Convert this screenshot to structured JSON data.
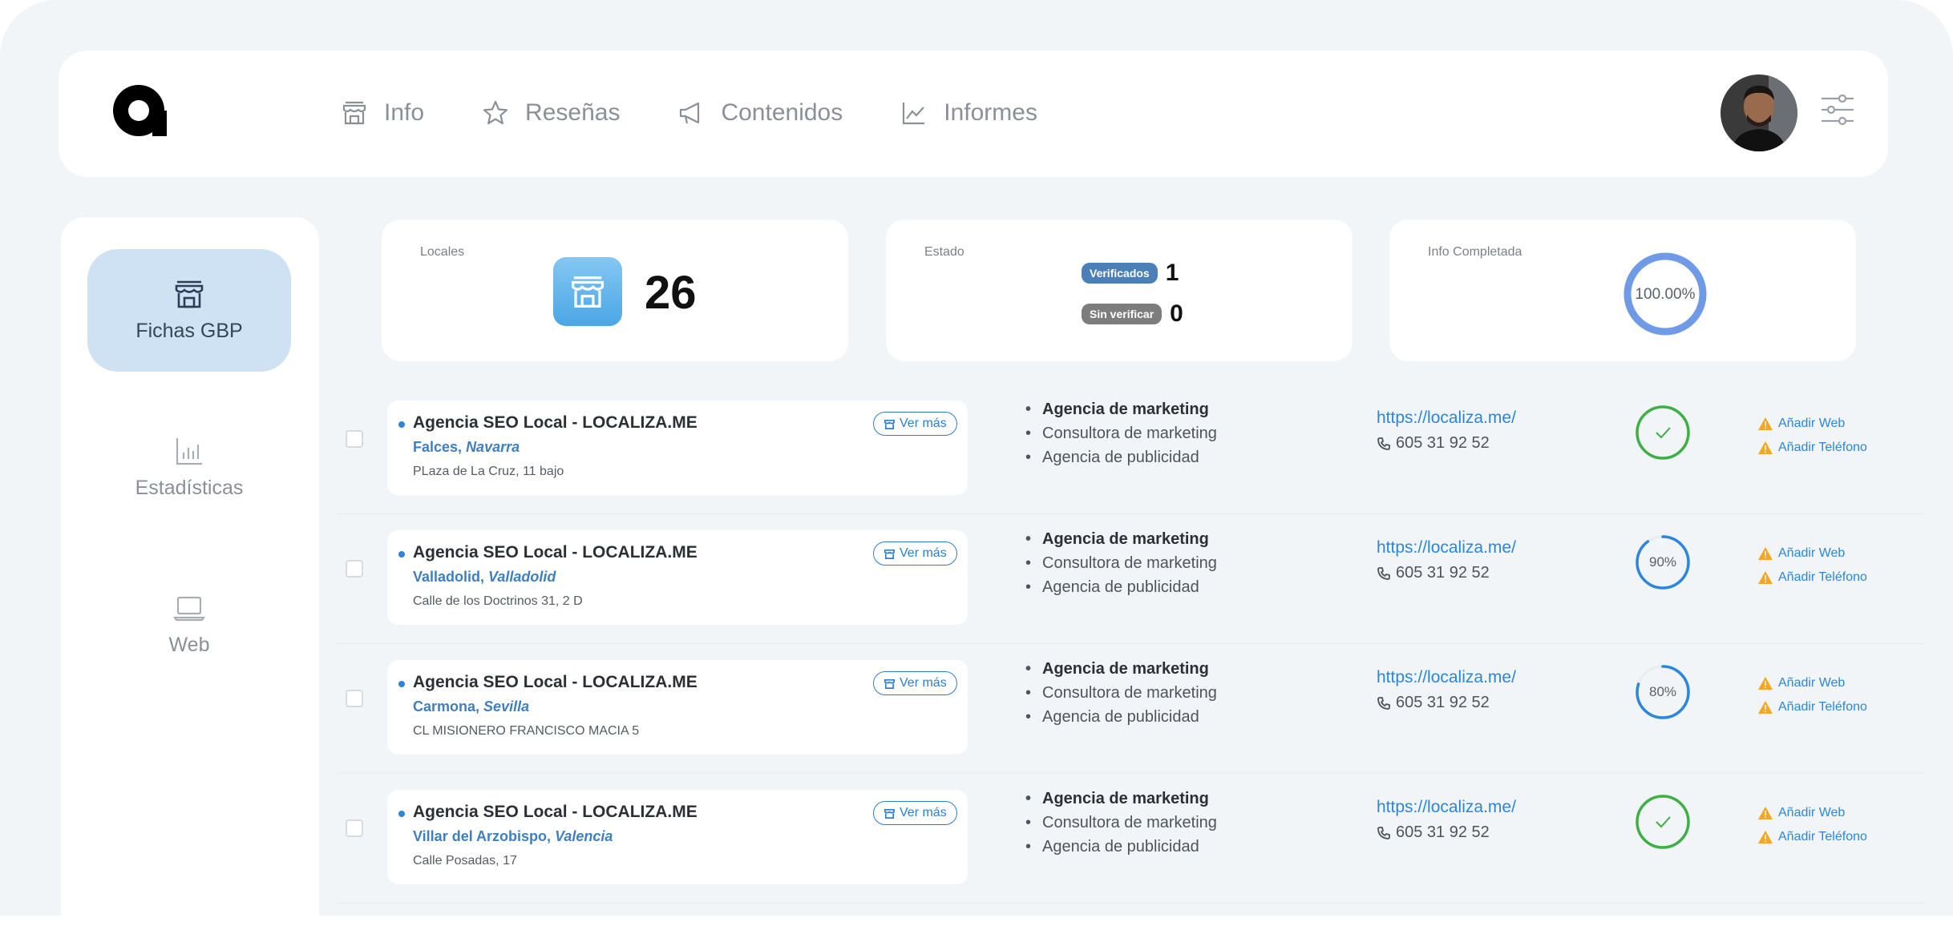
{
  "nav": {
    "items": [
      {
        "label": "Info",
        "icon": "store-icon"
      },
      {
        "label": "Reseñas",
        "icon": "star-icon"
      },
      {
        "label": "Contenidos",
        "icon": "megaphone-icon"
      },
      {
        "label": "Informes",
        "icon": "line-chart-icon"
      }
    ]
  },
  "sidebar": {
    "items": [
      {
        "label": "Fichas GBP",
        "icon": "store-icon",
        "active": true
      },
      {
        "label": "Estadísticas",
        "icon": "bar-chart-icon",
        "active": false
      },
      {
        "label": "Web",
        "icon": "laptop-icon",
        "active": false
      }
    ]
  },
  "stats": {
    "locales": {
      "label": "Locales",
      "count": "26"
    },
    "estado": {
      "label": "Estado",
      "verified_label": "Verificados",
      "verified_count": "1",
      "unverified_label": "Sin verificar",
      "unverified_count": "0"
    },
    "info": {
      "label": "Info Completada",
      "percent_text": "100.00%",
      "percent": 100
    }
  },
  "listings": [
    {
      "name": "Agencia SEO Local - LOCALIZA.ME",
      "city": "Falces,",
      "province": "Navarra",
      "address": "PLaza de La Cruz, 11 bajo",
      "ver_mas": "Ver más",
      "categories": [
        "Agencia de marketing",
        "Consultora de marketing",
        "Agencia de publicidad"
      ],
      "url": "https://localiza.me/",
      "phone": "605 31 92 52",
      "progress": 100,
      "progress_text": "",
      "warn_web": "Añadir Web",
      "warn_phone": "Añadir Teléfono"
    },
    {
      "name": "Agencia SEO Local - LOCALIZA.ME",
      "city": "Valladolid,",
      "province": "Valladolid",
      "address": "Calle de los Doctrinos 31, 2 D",
      "ver_mas": "Ver más",
      "categories": [
        "Agencia de marketing",
        "Consultora de marketing",
        "Agencia de publicidad"
      ],
      "url": "https://localiza.me/",
      "phone": "605 31 92 52",
      "progress": 90,
      "progress_text": "90%",
      "warn_web": "Añadir Web",
      "warn_phone": "Añadir Teléfono"
    },
    {
      "name": "Agencia SEO Local - LOCALIZA.ME",
      "city": "Carmona,",
      "province": "Sevilla",
      "address": "CL MISIONERO FRANCISCO MACIA 5",
      "ver_mas": "Ver más",
      "categories": [
        "Agencia de marketing",
        "Consultora de marketing",
        "Agencia de publicidad"
      ],
      "url": "https://localiza.me/",
      "phone": "605 31 92 52",
      "progress": 80,
      "progress_text": "80%",
      "warn_web": "Añadir Web",
      "warn_phone": "Añadir Teléfono"
    },
    {
      "name": "Agencia SEO Local - LOCALIZA.ME",
      "city": "Villar del Arzobispo,",
      "province": "Valencia",
      "address": "Calle Posadas, 17",
      "ver_mas": "Ver más",
      "categories": [
        "Agencia de marketing",
        "Consultora de marketing",
        "Agencia de publicidad"
      ],
      "url": "https://localiza.me/",
      "phone": "605 31 92 52",
      "progress": 100,
      "progress_text": "",
      "warn_web": "Añadir Web",
      "warn_phone": "Añadir Teléfono"
    }
  ],
  "colors": {
    "accent": "#2b86dc",
    "complete": "#3cb043",
    "partial": "#2b86dc",
    "verified": "#4a7fb8",
    "unverified": "#7d7d7d",
    "warning": "#f5a623"
  }
}
